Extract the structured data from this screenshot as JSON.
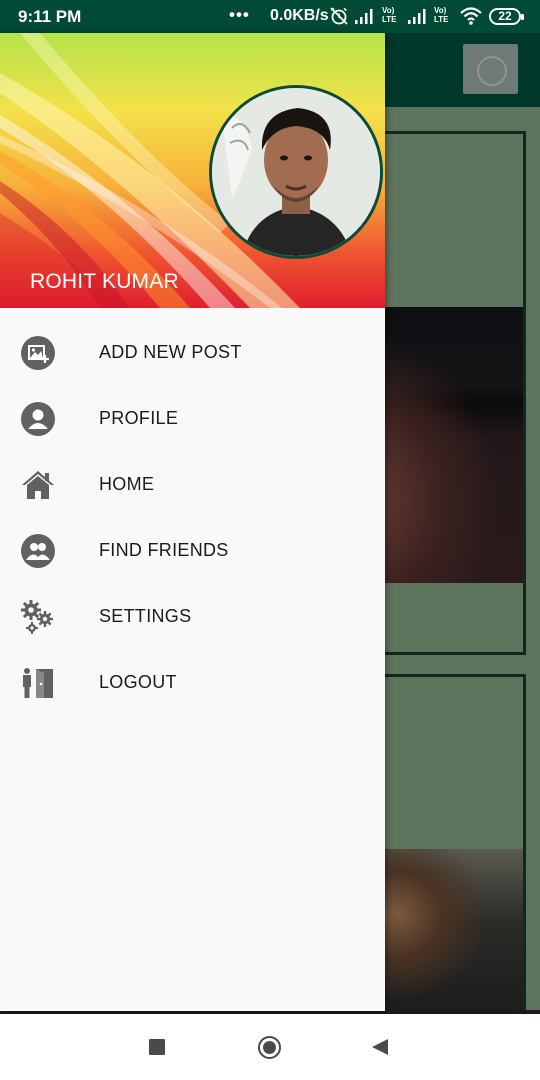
{
  "status_bar": {
    "time": "9:11 PM",
    "dots": "•••",
    "network_speed": "0.0KB/s",
    "volte_1_top": "Vo)",
    "volte_1_bottom": "LTE",
    "volte_2_top": "Vo)",
    "volte_2_bottom": "LTE",
    "battery_level": "22",
    "icons": [
      "alarm-off-icon",
      "signal-icon",
      "volte-icon",
      "signal-icon",
      "volte-icon",
      "wifi-icon",
      "battery-icon"
    ]
  },
  "drawer": {
    "header": {
      "user_name": "ROHIT KUMAR",
      "avatar_icon": "profile-photo"
    },
    "menu": [
      {
        "label": "ADD NEW POST",
        "icon": "add-image-icon"
      },
      {
        "label": "PROFILE",
        "icon": "person-icon"
      },
      {
        "label": "HOME",
        "icon": "home-icon"
      },
      {
        "label": "FIND FRIENDS",
        "icon": "people-icon"
      },
      {
        "label": "SETTINGS",
        "icon": "gears-icon"
      },
      {
        "label": "LOGOUT",
        "icon": "exit-door-icon"
      }
    ]
  },
  "colors": {
    "status_bar": "#004a36",
    "toolbar": "#00382b",
    "menu_icon": "#616161",
    "drawer_bg": "#f9f9f9"
  },
  "nav_bar": {
    "icons": [
      "recents-square-icon",
      "home-circle-icon",
      "back-triangle-icon"
    ]
  }
}
